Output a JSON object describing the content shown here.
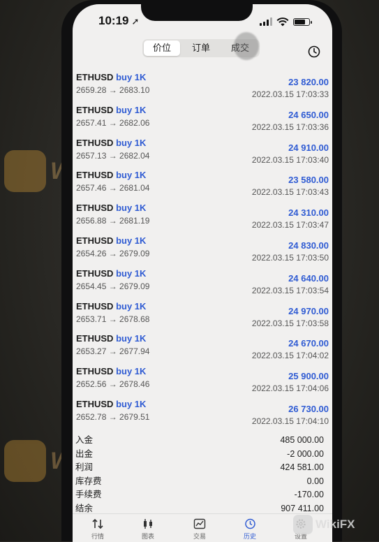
{
  "status_bar": {
    "time": "10:19",
    "location_glyph": "➚"
  },
  "header": {
    "segments": [
      "价位",
      "订单",
      "成交"
    ],
    "active_segment": 0
  },
  "deals": [
    {
      "symbol": "ETHUSD",
      "type": "buy 1K",
      "prices": "2659.28 → 2683.10",
      "profit": "23 820.00",
      "time": "2022.03.15 17:03:33"
    },
    {
      "symbol": "ETHUSD",
      "type": "buy 1K",
      "prices": "2657.41 → 2682.06",
      "profit": "24 650.00",
      "time": "2022.03.15 17:03:36"
    },
    {
      "symbol": "ETHUSD",
      "type": "buy 1K",
      "prices": "2657.13 → 2682.04",
      "profit": "24 910.00",
      "time": "2022.03.15 17:03:40"
    },
    {
      "symbol": "ETHUSD",
      "type": "buy 1K",
      "prices": "2657.46 → 2681.04",
      "profit": "23 580.00",
      "time": "2022.03.15 17:03:43"
    },
    {
      "symbol": "ETHUSD",
      "type": "buy 1K",
      "prices": "2656.88 → 2681.19",
      "profit": "24 310.00",
      "time": "2022.03.15 17:03:47"
    },
    {
      "symbol": "ETHUSD",
      "type": "buy 1K",
      "prices": "2654.26 → 2679.09",
      "profit": "24 830.00",
      "time": "2022.03.15 17:03:50"
    },
    {
      "symbol": "ETHUSD",
      "type": "buy 1K",
      "prices": "2654.45 → 2679.09",
      "profit": "24 640.00",
      "time": "2022.03.15 17:03:54"
    },
    {
      "symbol": "ETHUSD",
      "type": "buy 1K",
      "prices": "2653.71 → 2678.68",
      "profit": "24 970.00",
      "time": "2022.03.15 17:03:58"
    },
    {
      "symbol": "ETHUSD",
      "type": "buy 1K",
      "prices": "2653.27 → 2677.94",
      "profit": "24 670.00",
      "time": "2022.03.15 17:04:02"
    },
    {
      "symbol": "ETHUSD",
      "type": "buy 1K",
      "prices": "2652.56 → 2678.46",
      "profit": "25 900.00",
      "time": "2022.03.15 17:04:06"
    },
    {
      "symbol": "ETHUSD",
      "type": "buy 1K",
      "prices": "2652.78 → 2679.51",
      "profit": "26 730.00",
      "time": "2022.03.15 17:04:10"
    }
  ],
  "summary": [
    {
      "label": "入金",
      "value": "485 000.00"
    },
    {
      "label": "出金",
      "value": "-2 000.00"
    },
    {
      "label": "利润",
      "value": "424 581.00"
    },
    {
      "label": "库存费",
      "value": "0.00"
    },
    {
      "label": "手续费",
      "value": "-170.00"
    },
    {
      "label": "结余",
      "value": "907 411.00"
    }
  ],
  "tabbar": [
    {
      "icon": "quotes-icon",
      "label": "行情"
    },
    {
      "icon": "chart-icon",
      "label": "图表"
    },
    {
      "icon": "trade-icon",
      "label": "交易"
    },
    {
      "icon": "history-icon",
      "label": "历史"
    },
    {
      "icon": "settings-icon",
      "label": "设置"
    }
  ],
  "active_tab": 3,
  "watermark": "WikiFX",
  "colors": {
    "accent": "#2f5bd3",
    "screen_bg": "#f1f0ef"
  }
}
